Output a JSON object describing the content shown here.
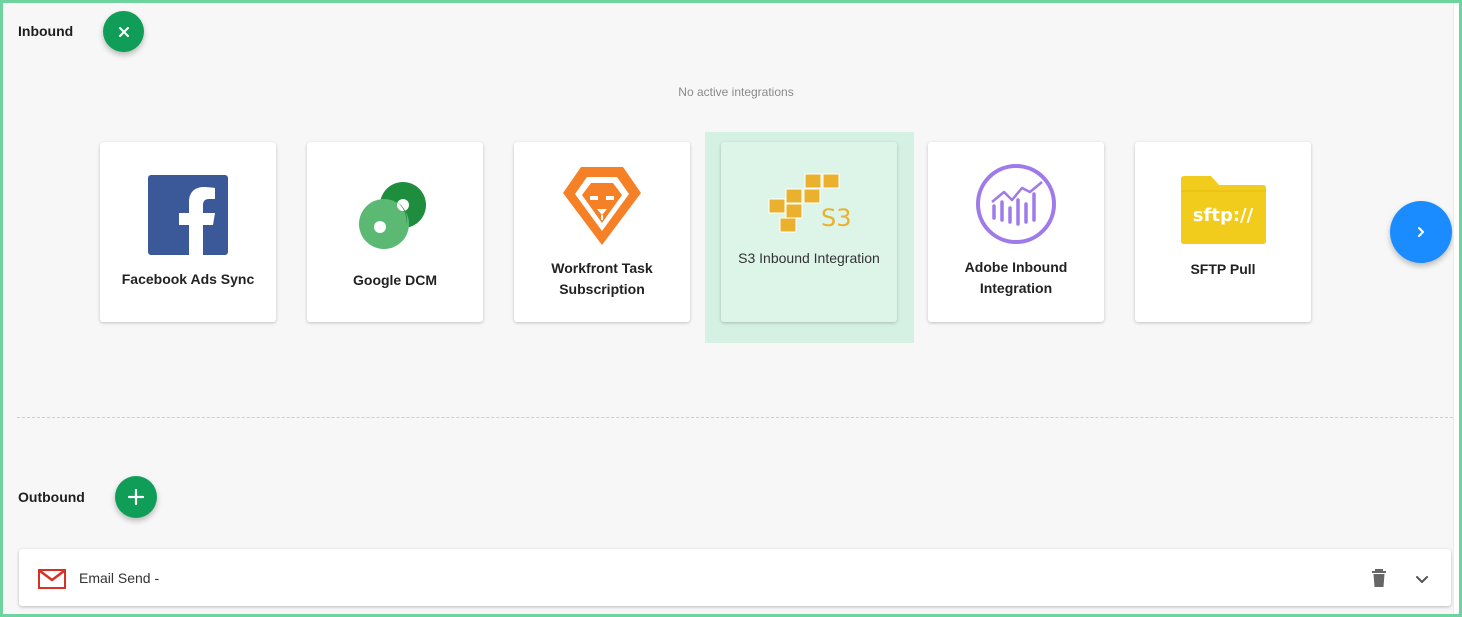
{
  "inbound": {
    "title": "Inbound",
    "close_icon": "close-icon",
    "empty_message": "No active integrations",
    "cards": [
      {
        "name": "card-facebook-ads-sync",
        "label": "Facebook Ads Sync",
        "icon": "facebook-icon",
        "color": "#3b5998"
      },
      {
        "name": "card-google-dcm",
        "label": "Google DCM",
        "icon": "google-dcm-icon",
        "color": "#34a853"
      },
      {
        "name": "card-workfront-task-subscription",
        "label": "Workfront Task Subscription",
        "icon": "workfront-icon",
        "color": "#f58025"
      },
      {
        "name": "card-s3-inbound-integration",
        "label": "S3 Inbound Integration",
        "icon": "aws-s3-icon",
        "color": "#e9b12e"
      },
      {
        "name": "card-adobe-inbound-integration",
        "label": "Adobe Inbound Integration",
        "icon": "adobe-analytics-icon",
        "color": "#9f7aea"
      },
      {
        "name": "card-sftp-pull",
        "label": "SFTP Pull",
        "icon": "sftp-folder-icon",
        "color": "#f2cc1c"
      }
    ],
    "sftp_text": "sftp://",
    "s3_text": "S3",
    "next_icon": "chevron-right-icon"
  },
  "outbound": {
    "title": "Outbound",
    "add_icon": "plus-icon",
    "items": [
      {
        "label": "Email Send -",
        "icon": "gmail-icon",
        "delete_icon": "trash-icon",
        "expand_icon": "chevron-down-icon"
      }
    ]
  },
  "colors": {
    "green_fab": "#0f9d58",
    "blue_fab": "#1a8cff",
    "selected_bg": "#d4f1e4",
    "border_green": "#6fd3a0"
  }
}
